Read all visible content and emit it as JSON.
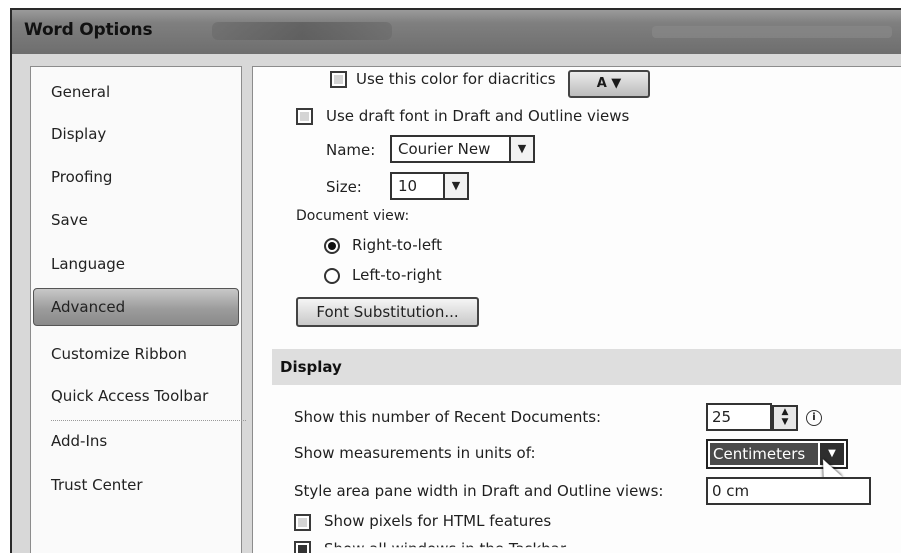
{
  "window": {
    "title": "Word Options"
  },
  "sidebar": {
    "items": [
      {
        "label": "General"
      },
      {
        "label": "Display"
      },
      {
        "label": "Proofing"
      },
      {
        "label": "Save"
      },
      {
        "label": "Language"
      },
      {
        "label": "Advanced",
        "active": true
      },
      {
        "label": "Customize Ribbon"
      },
      {
        "label": "Quick Access Toolbar"
      },
      {
        "label": "Add-Ins"
      },
      {
        "label": "Trust Center"
      }
    ]
  },
  "options": {
    "diacritics_color": {
      "label": "Use this color for diacritics",
      "checked": false
    },
    "draft_font": {
      "label": "Use draft font in Draft and Outline views",
      "checked": false
    },
    "name": {
      "label": "Name:",
      "value": "Courier New"
    },
    "size": {
      "label": "Size:",
      "value": "10"
    },
    "document_view": {
      "label": "Document view:",
      "rtl": "Right-to-left",
      "ltr": "Left-to-right",
      "selected": "Right-to-left"
    },
    "font_substitution_button": "Font Substitution..."
  },
  "display_section": {
    "title": "Display",
    "recent_docs": {
      "label": "Show this number of Recent Documents:",
      "value": "25"
    },
    "measurement_units": {
      "label": "Show measurements in units of:",
      "value": "Centimeters"
    },
    "style_area": {
      "label": "Style area pane width in Draft and Outline views:",
      "value": "0 cm"
    },
    "show_pixels": {
      "label": "Show pixels for HTML features",
      "checked": false
    },
    "show_all_windows": {
      "label": "Show all windows in the Taskbar",
      "checked": true
    }
  },
  "icons": [
    "font-color-icon",
    "chevron-down-icon",
    "spin-up-icon",
    "spin-down-icon",
    "info-icon",
    "mouse-pointer-icon"
  ]
}
